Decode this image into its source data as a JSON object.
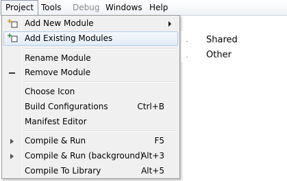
{
  "menubar": {
    "items": [
      {
        "label": "Project",
        "state": "active"
      },
      {
        "label": "Tools",
        "state": "normal"
      },
      {
        "label": "Debug",
        "state": "disabled"
      },
      {
        "label": "Windows",
        "state": "normal"
      },
      {
        "label": "Help",
        "state": "normal"
      }
    ]
  },
  "project_menu": {
    "items": [
      {
        "label": "Add New Module",
        "icon": "add-module-icon",
        "has_submenu": true
      },
      {
        "label": "Add Existing Modules",
        "icon": "add-existing-module-icon",
        "highlighted": true
      },
      {
        "label": "Rename Module"
      },
      {
        "label": "Remove Module",
        "icon": "minus-icon"
      },
      {
        "label": "Choose Icon"
      },
      {
        "label": "Build Configurations",
        "shortcut": "Ctrl+B"
      },
      {
        "label": "Manifest Editor"
      },
      {
        "label": "Compile & Run",
        "shortcut": "F5",
        "icon": "play-icon"
      },
      {
        "label": "Compile & Run (background)",
        "shortcut": "Alt+3",
        "icon": "play-icon"
      },
      {
        "label": "Compile To Library",
        "shortcut": "Alt+5"
      }
    ]
  },
  "submenu": {
    "items": [
      "Shared",
      "Other"
    ]
  },
  "colors": {
    "highlight_border": "#aecbf0",
    "menu_background": "#f0f0f0",
    "disabled_text": "#8a8a8a"
  }
}
